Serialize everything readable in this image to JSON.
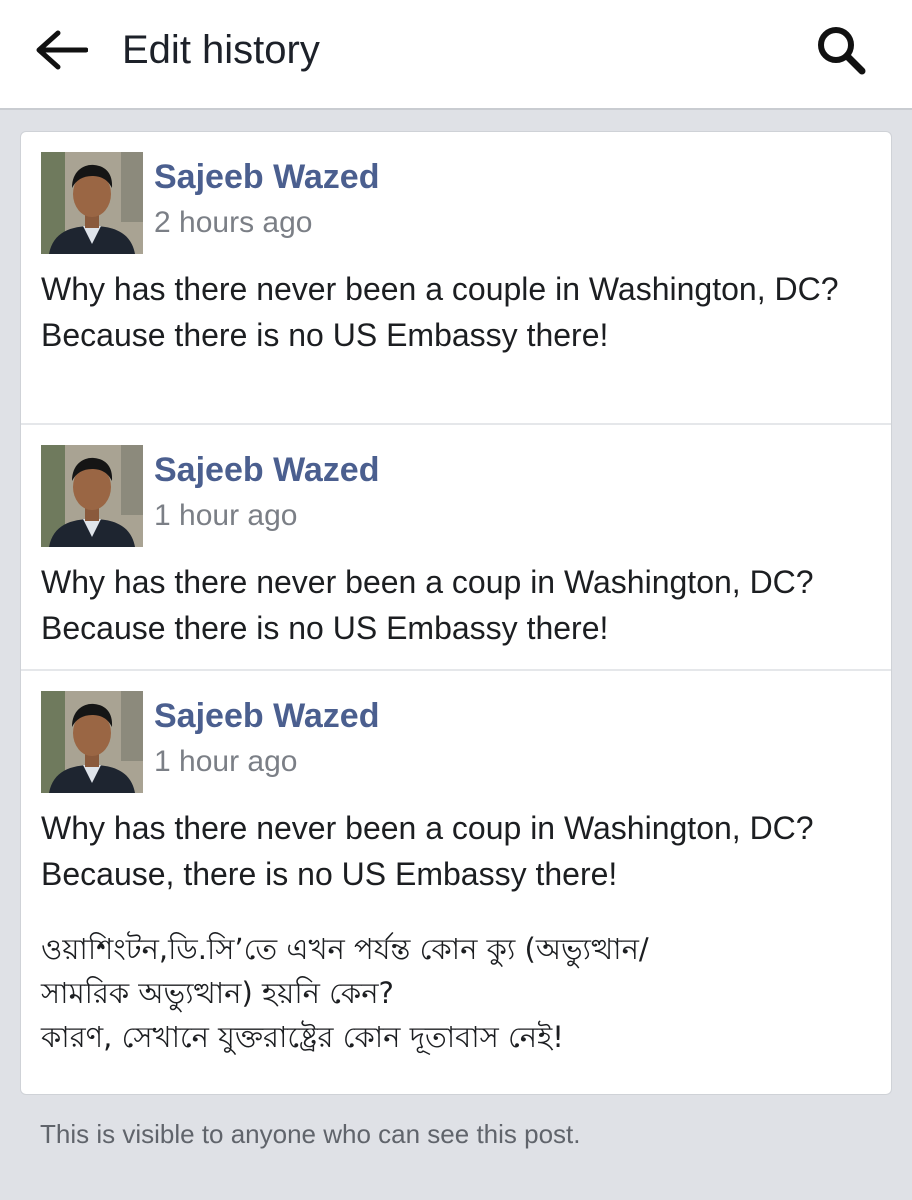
{
  "appbar": {
    "title": "Edit history",
    "back_icon": "arrow-left-icon",
    "search_icon": "search-icon"
  },
  "entries": [
    {
      "author": "Sajeeb Wazed",
      "time": "2 hours ago",
      "lines": [
        "Why has there never been a couple in Washington, DC?",
        "Because there is no US Embassy there!"
      ]
    },
    {
      "author": "Sajeeb Wazed",
      "time": "1 hour ago",
      "lines": [
        "Why has there never been a coup in Washington, DC?",
        "Because there is no US Embassy there!"
      ]
    },
    {
      "author": "Sajeeb Wazed",
      "time": "1 hour ago",
      "lines": [
        "Why has there never been a coup in Washington, DC?",
        "Because, there is no US Embassy there!"
      ],
      "bengali_lines": [
        "ওয়াশিংটন,ডি.সি’তে এখন পর্যন্ত কোন ক্যু (অভ্যুত্থান/",
        "সামরিক অভ্যুত্থান) হয়নি কেন?",
        "কারণ, সেখানে যুক্তরাষ্ট্রের কোন দূতাবাস নেই!"
      ]
    }
  ],
  "footer_note": "This is visible to anyone who can see this post.",
  "colors": {
    "author_name": "#4b5f8f",
    "timestamp": "#7b7f86",
    "page_background": "#dfe1e6"
  }
}
